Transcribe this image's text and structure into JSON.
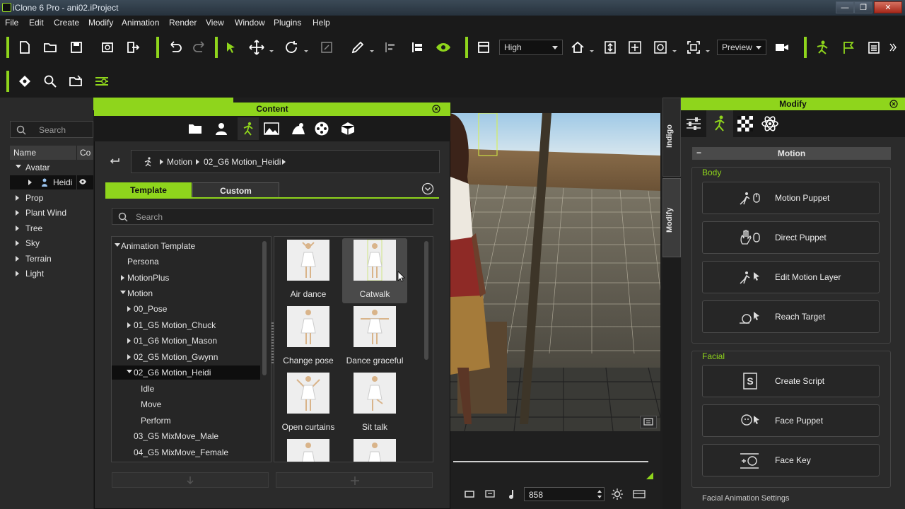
{
  "window": {
    "title": "iClone 6 Pro - ani02.iProject",
    "close": "✕",
    "restore": "❐",
    "minimize": "—"
  },
  "menu": [
    "File",
    "Edit",
    "Create",
    "Modify",
    "Animation",
    "Render",
    "View",
    "Window",
    "Plugins",
    "Help"
  ],
  "toolbar": {
    "quality": "High",
    "render_mode": "Preview"
  },
  "scene": {
    "search_placeholder": "Search",
    "col_name": "Name",
    "col_co": "Co",
    "items": {
      "avatar": "Avatar",
      "heidi": "Heidi",
      "prop": "Prop",
      "plant_wind": "Plant Wind",
      "tree": "Tree",
      "sky": "Sky",
      "terrain": "Terrain",
      "light": "Light"
    }
  },
  "content": {
    "title": "Content",
    "breadcrumb": [
      "Motion",
      "02_G6 Motion_Heidi"
    ],
    "tabs": {
      "template": "Template",
      "custom": "Custom"
    },
    "search_placeholder": "Search",
    "tree": {
      "root": "Animation Template",
      "persona": "Persona",
      "motionplus": "MotionPlus",
      "motion": "Motion",
      "pose": "00_Pose",
      "chuck": "01_G5 Motion_Chuck",
      "mason": "01_G6 Motion_Mason",
      "gwynn": "02_G5 Motion_Gwynn",
      "heidi": "02_G6 Motion_Heidi",
      "idle": "Idle",
      "move": "Move",
      "perform": "Perform",
      "male": "03_G5 MixMove_Male",
      "female": "04_G5 MixMove_Female"
    },
    "thumbs": [
      "Air dance",
      "Catwalk",
      "Change pose",
      "Dance graceful",
      "Open curtains",
      "Sit talk"
    ]
  },
  "viewport": {
    "frame": "858"
  },
  "sidetabs": {
    "indigo": "Indigo",
    "modify": "Modify"
  },
  "modify": {
    "title": "Modify",
    "section": "Motion",
    "body_label": "Body",
    "facial_label": "Facial",
    "body_buttons": [
      "Motion Puppet",
      "Direct Puppet",
      "Edit Motion Layer",
      "Reach Target"
    ],
    "facial_buttons": [
      "Create Script",
      "Face Puppet",
      "Face Key"
    ],
    "footer_label": "Facial Animation Settings"
  },
  "colors": {
    "accent": "#8fd51c",
    "panel": "#2b2b2b",
    "dark": "#1a1a1a"
  }
}
